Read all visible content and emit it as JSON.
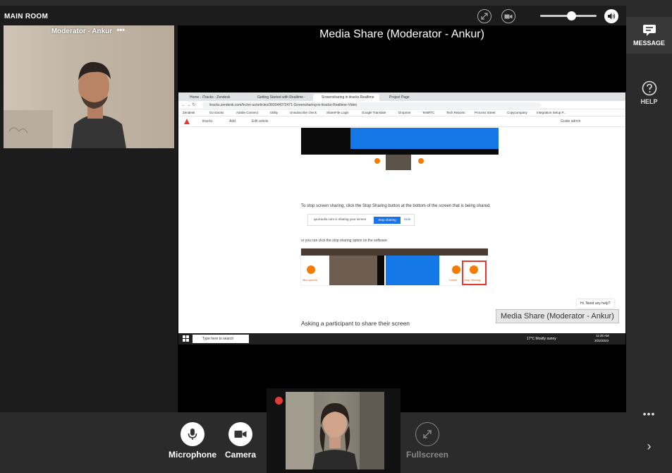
{
  "room": {
    "label": "MAIN ROOM"
  },
  "toolbar": {
    "expand_icon": "expand-icon",
    "video_icon": "video-off-icon",
    "volume_level": 0.55,
    "volume_icon": "speaker-icon"
  },
  "moderator": {
    "name": "Moderator - Ankur",
    "menu": "•••"
  },
  "share": {
    "title": "Media Share (Moderator - Ankur)",
    "tooltip": "Media Share (Moderator - Ankur)"
  },
  "browser": {
    "tabs": [
      "Home - iTracks - Zendesk",
      "Getting Started with Realtime -",
      "Screensharing in itracks Realtime",
      "Project Page"
    ],
    "url": "itracks.zendesk.com/hc/en-us/articles/360044372471-Screensharing-in-itracks-Realtime-Video",
    "bookmarks": [
      "Zendesk",
      "Go itracks",
      "Adobe Connect",
      "Utility",
      "Unsubscribe check",
      "ShareFile Login",
      "Google Translate",
      "Dropmer",
      "TestRTC",
      "Tech Reports",
      "Process Street",
      "Copycompany",
      "Integration Setup P..."
    ],
    "nav": [
      "itracks",
      "Add",
      "Edit article"
    ],
    "nav_right": "Guide admin",
    "stop_text": "To stop screen sharing, click the Stop Sharing button at the bottom of the screen that is being shared.",
    "stop_bar_text": "qa.itracks.com is sharing your screen",
    "stop_button": "Stop sharing",
    "hide": "Hide",
    "or_text": "or you can click the stop sharing option on the software",
    "mic_label": "Microphone",
    "stop_label": "Stop Sharing",
    "leave_label": "Leave",
    "ask_text": "Asking a participant to share their screen",
    "help_bubble": "Hi. Need any help?",
    "taskbar_search": "Type here to search",
    "weather": "17°C  Mostly sunny",
    "clock_time": "11:25 AM",
    "clock_date": "3/22/2023"
  },
  "controls": {
    "microphone": "Microphone",
    "camera": "Camera",
    "fullscreen": "Fullscreen"
  },
  "sidebar": {
    "message": "MESSAGE",
    "help": "HELP",
    "more": "•••",
    "next": "›"
  },
  "colors": {
    "accent_red": "#e53935",
    "chrome_blue": "#1a73e8",
    "panel": "#2b2b2b"
  }
}
